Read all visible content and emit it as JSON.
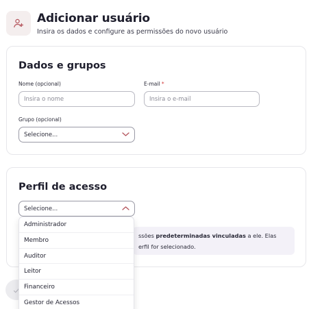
{
  "header": {
    "icon": "add-user-icon",
    "title": "Adicionar usuário",
    "subtitle": "Insira os dados e configure as permissões do novo usuário"
  },
  "dados": {
    "title": "Dados e grupos",
    "name_label": "Nome (opcional)",
    "name_placeholder": "Insira o nome",
    "name_value": "",
    "email_label": "E-mail",
    "email_required_mark": "*",
    "email_placeholder": "Insira o e-mail",
    "email_value": "",
    "group_label": "Grupo (opcional)",
    "group_selected": "Selecione..."
  },
  "perfil": {
    "title": "Perfil de acesso",
    "selected": "Selecione...",
    "info_part1": "ssões ",
    "info_bold": "predeterminadas vinculadas",
    "info_part2": " a ele. Elas",
    "info_line2": "erfil for selecionado.",
    "options": [
      "Administrador",
      "Membro",
      "Auditor",
      "Leitor",
      "Financeiro",
      "Gestor de Acessos"
    ]
  },
  "footer": {
    "icon": "check-icon"
  },
  "colors": {
    "accent": "#b4535b",
    "required": "#d23a3a",
    "info_bg": "#f3f1f8"
  }
}
